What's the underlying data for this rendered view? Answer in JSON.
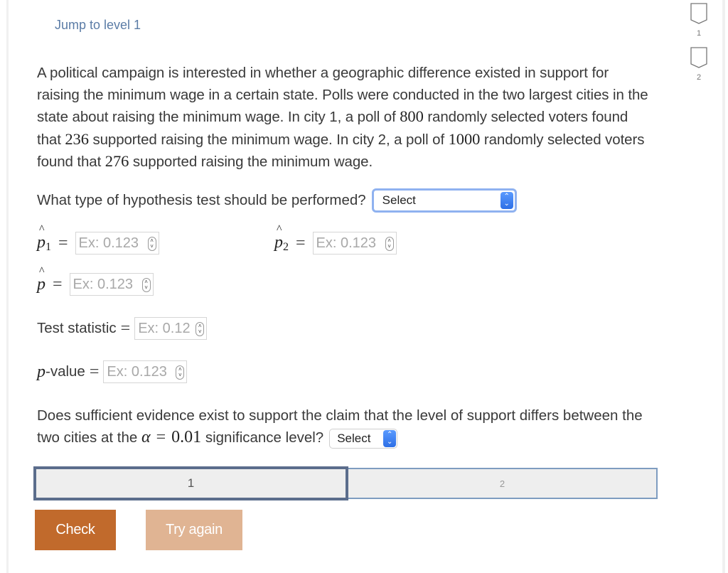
{
  "header": {
    "jump_link": "Jump to level 1"
  },
  "level_nav": {
    "items": [
      {
        "label": "1",
        "completed": false
      },
      {
        "label": "2",
        "completed": false
      }
    ]
  },
  "problem": {
    "segments": [
      "A political campaign is interested in whether a geographic difference existed in support for raising the minimum wage in a certain state. Polls were conducted in the two largest cities in the state about raising the minimum wage. In city 1, a poll of ",
      "800",
      " randomly selected voters found that ",
      "236",
      " supported raising the minimum wage. In city 2, a poll of ",
      "1000",
      " randomly selected voters found that ",
      "276",
      " supported raising the minimum wage."
    ]
  },
  "question1": {
    "label": "What type of hypothesis test should be performed?",
    "select_value": "Select"
  },
  "fields": {
    "p1": {
      "symbol": "p",
      "subscript": "1",
      "placeholder": "Ex: 0.123"
    },
    "p2": {
      "symbol": "p",
      "subscript": "2",
      "placeholder": "Ex: 0.123"
    },
    "p_pooled": {
      "symbol": "p",
      "placeholder": "Ex: 0.123"
    },
    "test_statistic": {
      "label": "Test statistic",
      "placeholder": "Ex: 0.12"
    },
    "p_value": {
      "label_italic": "p",
      "label_rest": "-value",
      "placeholder": "Ex: 0.123"
    },
    "equals": "="
  },
  "question2": {
    "text_before": "Does sufficient evidence exist to support the claim that the level of support differs between the two cities at the ",
    "alpha_symbol": "α",
    "equals": "=",
    "alpha_value": "0.01",
    "text_after": " significance level?",
    "select_value": "Select"
  },
  "level_tabs": [
    {
      "label": "1",
      "active": true
    },
    {
      "label": "2",
      "active": false
    }
  ],
  "buttons": {
    "check": "Check",
    "try_again": "Try again"
  },
  "colors": {
    "link": "#5b7ca6",
    "check_button": "#c16a2c",
    "try_again_button": "#e0b493",
    "active_tab_border": "#5b6d8c",
    "select_focus": "#8fb2f0"
  }
}
